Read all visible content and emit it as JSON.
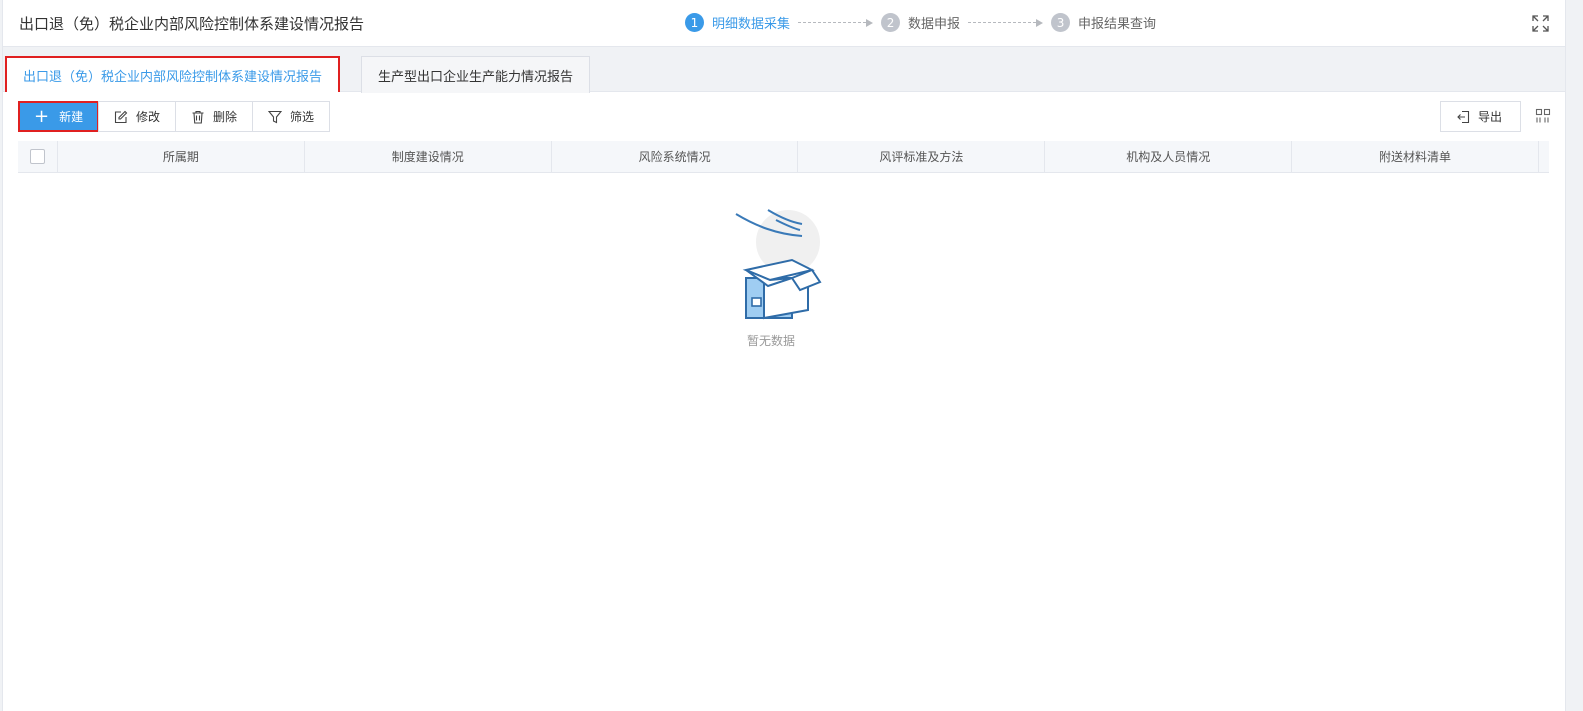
{
  "header": {
    "title": "出口退（免）税企业内部风险控制体系建设情况报告",
    "steps": [
      {
        "num": "1",
        "label": "明细数据采集",
        "active": true
      },
      {
        "num": "2",
        "label": "数据申报",
        "active": false
      },
      {
        "num": "3",
        "label": "申报结果查询",
        "active": false
      }
    ],
    "fullscreen_icon": "fullscreen-icon"
  },
  "tabs": [
    {
      "label": "出口退（免）税企业内部风险控制体系建设情况报告",
      "active": true
    },
    {
      "label": "生产型出口企业生产能力情况报告",
      "active": false
    }
  ],
  "toolbar": {
    "new_label": "新建",
    "edit_label": "修改",
    "delete_label": "删除",
    "filter_label": "筛选",
    "export_label": "导出"
  },
  "table": {
    "columns": [
      "所属期",
      "制度建设情况",
      "风险系统情况",
      "风评标准及方法",
      "机构及人员情况",
      "附送材料清单"
    ],
    "rows": [],
    "empty_text": "暂无数据"
  },
  "colors": {
    "accent": "#3a9ae8",
    "highlight_border": "#e02020"
  }
}
